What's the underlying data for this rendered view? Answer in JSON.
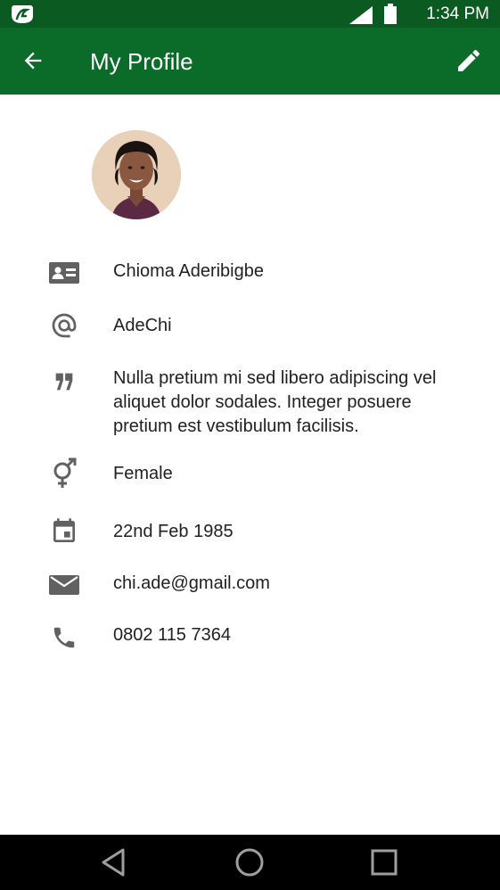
{
  "status_bar": {
    "time": "1:34 PM",
    "icons": [
      "app-icon",
      "signal-icon",
      "battery-icon"
    ]
  },
  "app_bar": {
    "title": "My Profile",
    "back_icon": "arrow-left-icon",
    "edit_icon": "pencil-icon"
  },
  "profile": {
    "avatar": "avatar-photo",
    "fields": [
      {
        "icon": "id-card-icon",
        "value": "Chioma Aderibigbe"
      },
      {
        "icon": "at-sign-icon",
        "value": "AdeChi"
      },
      {
        "icon": "quote-icon",
        "value": "Nulla pretium mi sed libero adipiscing vel aliquet dolor sodales. Integer posuere pretium est vestibulum facilisis."
      },
      {
        "icon": "gender-icon",
        "value": "Female"
      },
      {
        "icon": "calendar-icon",
        "value": "22nd Feb 1985"
      },
      {
        "icon": "email-icon",
        "value": "chi.ade@gmail.com"
      },
      {
        "icon": "phone-icon",
        "value": "0802 115 7364"
      }
    ]
  },
  "nav_bar": {
    "buttons": [
      "back-triangle-icon",
      "home-circle-icon",
      "recents-square-icon"
    ]
  },
  "colors": {
    "status_bar": "#0a5a21",
    "app_bar": "#0b6b28",
    "icon_gray": "#616161",
    "text": "#212121"
  }
}
